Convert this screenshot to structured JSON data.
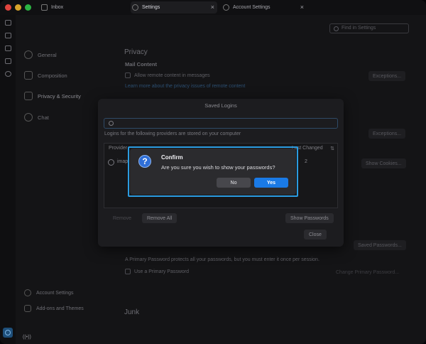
{
  "tabs": [
    {
      "label": "Inbox"
    },
    {
      "label": "Settings"
    },
    {
      "label": "Account Settings"
    }
  ],
  "tab_close_glyph": "×",
  "sidebar": {
    "items": [
      {
        "label": "General",
        "icon": "gear-icon"
      },
      {
        "label": "Composition",
        "icon": "pencil-icon"
      },
      {
        "label": "Privacy & Security",
        "icon": "lock-icon"
      },
      {
        "label": "Chat",
        "icon": "chat-icon"
      }
    ],
    "bottom": [
      {
        "label": "Account Settings",
        "icon": "account-icon"
      },
      {
        "label": "Add-ons and Themes",
        "icon": "puzzle-icon"
      }
    ]
  },
  "main": {
    "search_placeholder": "Find in Settings",
    "privacy_heading": "Privacy",
    "mail_content_heading": "Mail Content",
    "remote_content_label": "Allow remote content in messages",
    "privacy_link": "Learn more about the privacy issues of remote content",
    "exceptions_1": "Exceptions...",
    "exceptions_2": "Exceptions...",
    "show_cookies": "Show Cookies...",
    "saved_passwords": "Saved Passwords...",
    "primary_password_desc": "A Primary Password protects all your passwords, but you must enter it once per session.",
    "use_primary_password": "Use a Primary Password",
    "change_primary_password": "Change Primary Password...",
    "junk_heading": "Junk"
  },
  "saved_logins": {
    "title": "Saved Logins",
    "filter_value": "",
    "description": "Logins for the following providers are stored on your computer",
    "columns": {
      "provider": "Provider",
      "changed": "Last Changed"
    },
    "column_picker": "⇅",
    "rows": [
      {
        "provider": "imap",
        "changed": "2"
      }
    ],
    "buttons": {
      "remove": "Remove",
      "remove_all": "Remove All",
      "show_passwords": "Show Passwords",
      "close": "Close"
    }
  },
  "confirm": {
    "icon_glyph": "?",
    "title": "Confirm",
    "message": "Are you sure you wish to show your passwords?",
    "no_label": "No",
    "yes_label": "Yes"
  },
  "status_glyph": "((•))",
  "colors": {
    "accent": "#1a7ae6",
    "focus_ring": "#2b9be0",
    "dialog_bg": "#2b2b2e"
  }
}
